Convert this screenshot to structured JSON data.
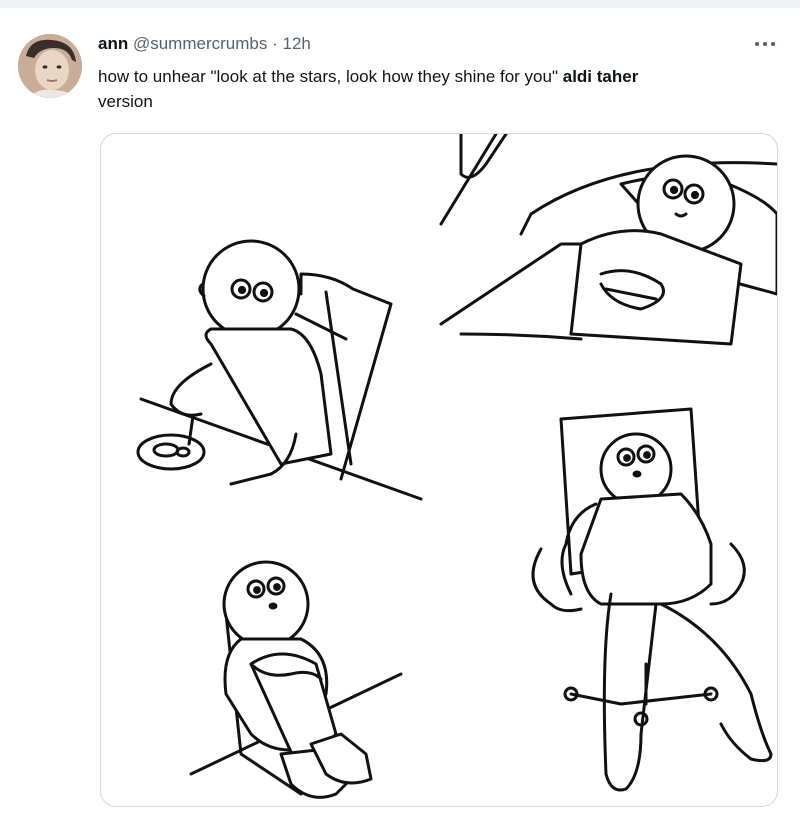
{
  "tweet": {
    "author_name": "ann",
    "author_handle": "@summercrumbs",
    "separator": "·",
    "time": "12h",
    "text_prefix": "how to unhear \"look at the stars, look how they shine for you\"",
    "text_bold": "aldi taher",
    "text_suffix": "version",
    "more_icon": "more-horizontal-icon"
  },
  "media": {
    "description_icon": "comic-image",
    "panels": [
      "eating-at-table",
      "lying-in-bed",
      "sitting-on-floor",
      "sitting-in-office-chair"
    ]
  },
  "colors": {
    "text": "#0f1419",
    "secondary": "#536471",
    "border": "#cfd9de"
  }
}
